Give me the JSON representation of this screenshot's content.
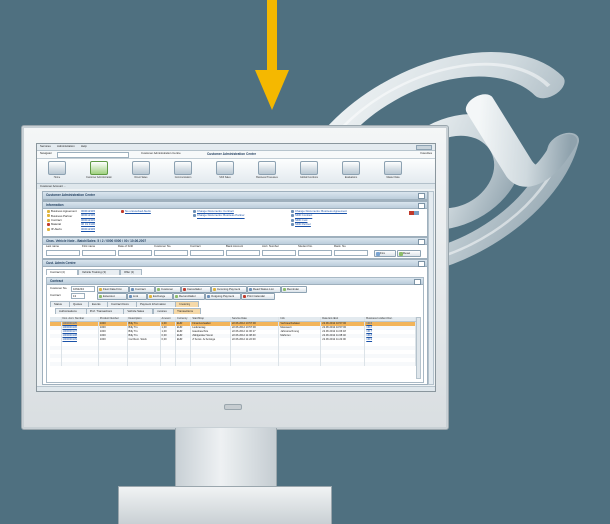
{
  "colors": {
    "background": "#4f7080",
    "arrow": "#f5b800",
    "selected_row": "#f2b45a",
    "at_symbol": "#dfe6ea"
  },
  "decor": {
    "arrow_icon": "down-arrow-icon",
    "at_icon": "at-sign-icon"
  },
  "menu": [
    "Services",
    "Administration",
    "Help"
  ],
  "nav": {
    "label": "Navigator",
    "crumb_1": "Customer Administration Centre",
    "crumb_2": "Customer Administration Centre",
    "right": "Favorites"
  },
  "toolbar": [
    {
      "label": "Home",
      "icon": "home-icon"
    },
    {
      "label": "Customer Administration",
      "icon": "folder-icon",
      "active": true
    },
    {
      "label": "Direct Sales",
      "icon": "folder-icon"
    },
    {
      "label": "Communication",
      "icon": "folder-icon"
    },
    {
      "label": "Shift Sales",
      "icon": "folder-icon"
    },
    {
      "label": "Business Processes",
      "icon": "folder-icon"
    },
    {
      "label": "Global Functions",
      "icon": "folder-icon"
    },
    {
      "label": "Evaluations",
      "icon": "folder-icon"
    },
    {
      "label": "Master Data",
      "icon": "folder-icon"
    }
  ],
  "breadcrumb": "Customer Account ...",
  "main_title": "Customer Administration Centre",
  "information": {
    "title": "Information",
    "col1": [
      "Business Agreement",
      "Business Partner",
      "Contract",
      "Material",
      "IP-Alerts"
    ],
    "col1_values": [
      "000012345",
      "000012345",
      "000012345",
      "00 01 0100",
      "000012345"
    ],
    "col2": [
      "No unresolved Alerts"
    ],
    "col3": [
      "Change Documents: Contract",
      "Change Documents: Business Partner"
    ],
    "col4": [
      "Change Documents: Business Agreement",
      "SDD Contract",
      "SDD Cust",
      "SDD Partner"
    ]
  },
  "vehicle": {
    "title": "Chas. Vehicle Note - Batch/Sales: 5 / 2 / 0000 0000 / 00 / 10.06.2007",
    "fields": [
      "Last name",
      "First name",
      "Date of birth",
      "Customer No.",
      "Contract",
      "Bank Account",
      "Acct. Number",
      "Student No.",
      "Rank. No."
    ],
    "find": "Find",
    "reset": "Reset"
  },
  "admin": {
    "title": "Cust. Admin Centre",
    "tabs": [
      "Contract (4)",
      "Vehicle Training (3)",
      "Offer (1)"
    ]
  },
  "contract": {
    "title": "Contract",
    "customer_no_label": "Customer No.",
    "customer_no": "1062234",
    "contract_label": "Contract",
    "contract_value": "13",
    "buttons": [
      "Flexi Data Finn",
      "Contract",
      "Customer",
      "Cancellation",
      "Incoming Payment",
      "Read Status List",
      "Reminder",
      "Extension",
      "Link",
      "Exchange",
      "Reconciliation",
      "Outgoing Payment",
      "Print Calendar"
    ],
    "subtabs": [
      "Status",
      "Quotes",
      "Events",
      "Contract Docs",
      "Payment Information",
      "Invoicing"
    ],
    "subtabs2": [
      "Authorisations",
      "Prof. Transactions",
      "Vehicle Sales",
      "Invoices",
      "Transactions"
    ],
    "table": {
      "headers": [
        "Doc. Acct. Number",
        "Product Number",
        "Description",
        "Amount",
        "Currency",
        "Start/Stop",
        "Service Date",
        "Info",
        "Date Ent./Exit",
        "Business Incident Doc."
      ],
      "rows": [
        [
          "1000000135",
          "1000",
          "Billy Tru",
          "1,00",
          "EUR",
          "Finanzverwaltet",
          "22.06.2012 10:57:00",
          "Verbrauchsdaten",
          "22.06.2012 10:57:00",
          "1315"
        ],
        [
          "1000000136",
          "1000",
          "Billy Tru",
          "1,00",
          "EUR",
          "Lieferantag",
          "22.06.2012 10:57:00",
          "Messwert",
          "22.06.2012 10:57:00",
          "1316"
        ],
        [
          "1000000137",
          "1000",
          "Billy Tru",
          "1,00",
          "EUR",
          "Hausbeschrie",
          "22.06.2012 11:06:17",
          "Jahresrechnung",
          "22.06.2012 11:06:18",
          "1317"
        ],
        [
          "1000000138",
          "1000",
          "Billy Tru",
          "0,00",
          "EUR",
          "Zählgeräte/ Sonst",
          "22.06.2012 11:08:40",
          "Mahnrun",
          "22.06.2012 11:08:40",
          "1318"
        ],
        [
          "1000000139",
          "1000",
          "Car Rent. Stock",
          "0,00",
          "EUR",
          "Z Sonst. Ä/ Anzeige",
          "22.06.2012 11:22:00",
          "",
          "22.06.2012 11:22:00",
          "1319"
        ]
      ]
    }
  }
}
